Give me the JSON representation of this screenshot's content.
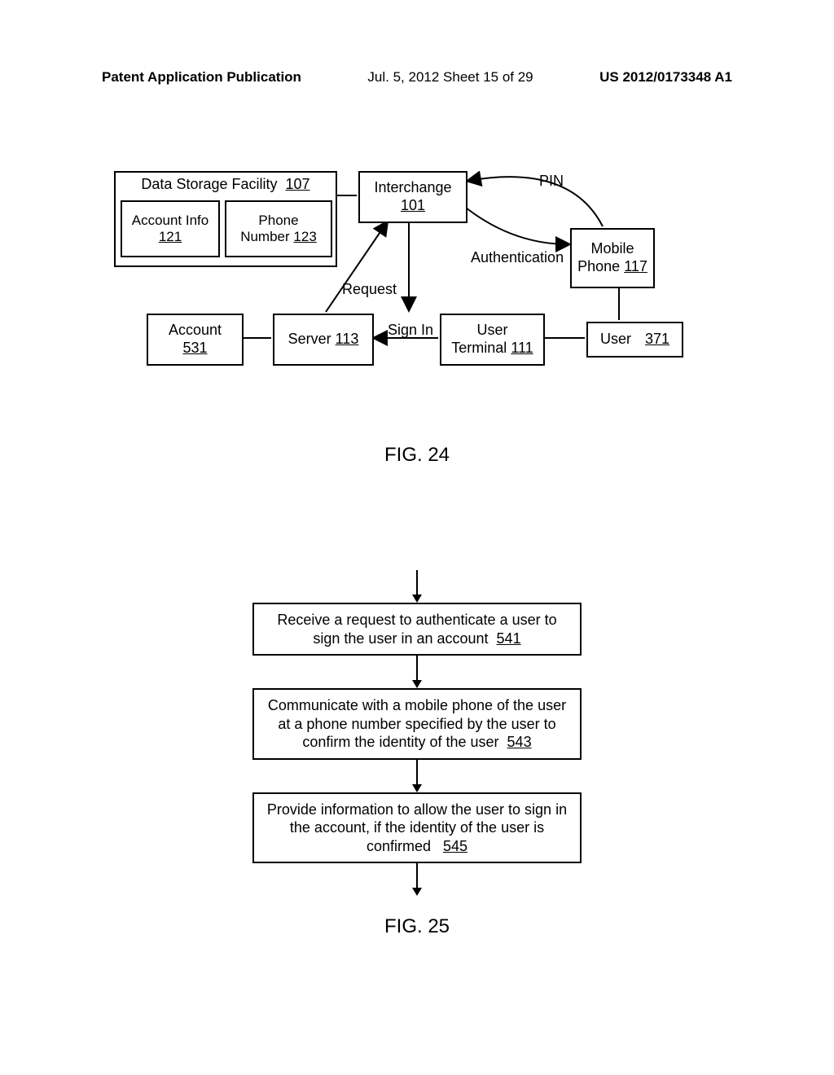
{
  "header": {
    "left": "Patent Application Publication",
    "center": "Jul. 5, 2012  Sheet 15 of 29",
    "right": "US 2012/0173348 A1"
  },
  "fig24": {
    "dsf_label": "Data Storage Facility",
    "dsf_ref": "107",
    "acctinfo_label": "Account Info",
    "acctinfo_ref": "121",
    "phonenum_label1": "Phone",
    "phonenum_label2": "Number",
    "phonenum_ref": "123",
    "interchange_label": "Interchange",
    "interchange_ref": "101",
    "mobile_label1": "Mobile",
    "mobile_label2": "Phone",
    "mobile_ref": "117",
    "account_label": "Account",
    "account_ref": "531",
    "server_label": "Server",
    "server_ref": "113",
    "userterm_label1": "User",
    "userterm_label2": "Terminal",
    "userterm_ref": "111",
    "user_label": "User",
    "user_ref": "371",
    "pin": "PIN",
    "authentication": "Authentication",
    "request": "Request",
    "signin": "Sign In",
    "caption": "FIG. 24"
  },
  "fig25": {
    "step1_text": "Receive a request to authenticate a user to sign the user in an account",
    "step1_ref": "541",
    "step2_text": "Communicate with a mobile phone of the user at a phone number specified by the user to confirm the identity of the user",
    "step2_ref": "543",
    "step3_text": "Provide information to allow the user to sign in the account, if the identity of the user is confirmed",
    "step3_ref": "545",
    "caption": "FIG. 25"
  }
}
